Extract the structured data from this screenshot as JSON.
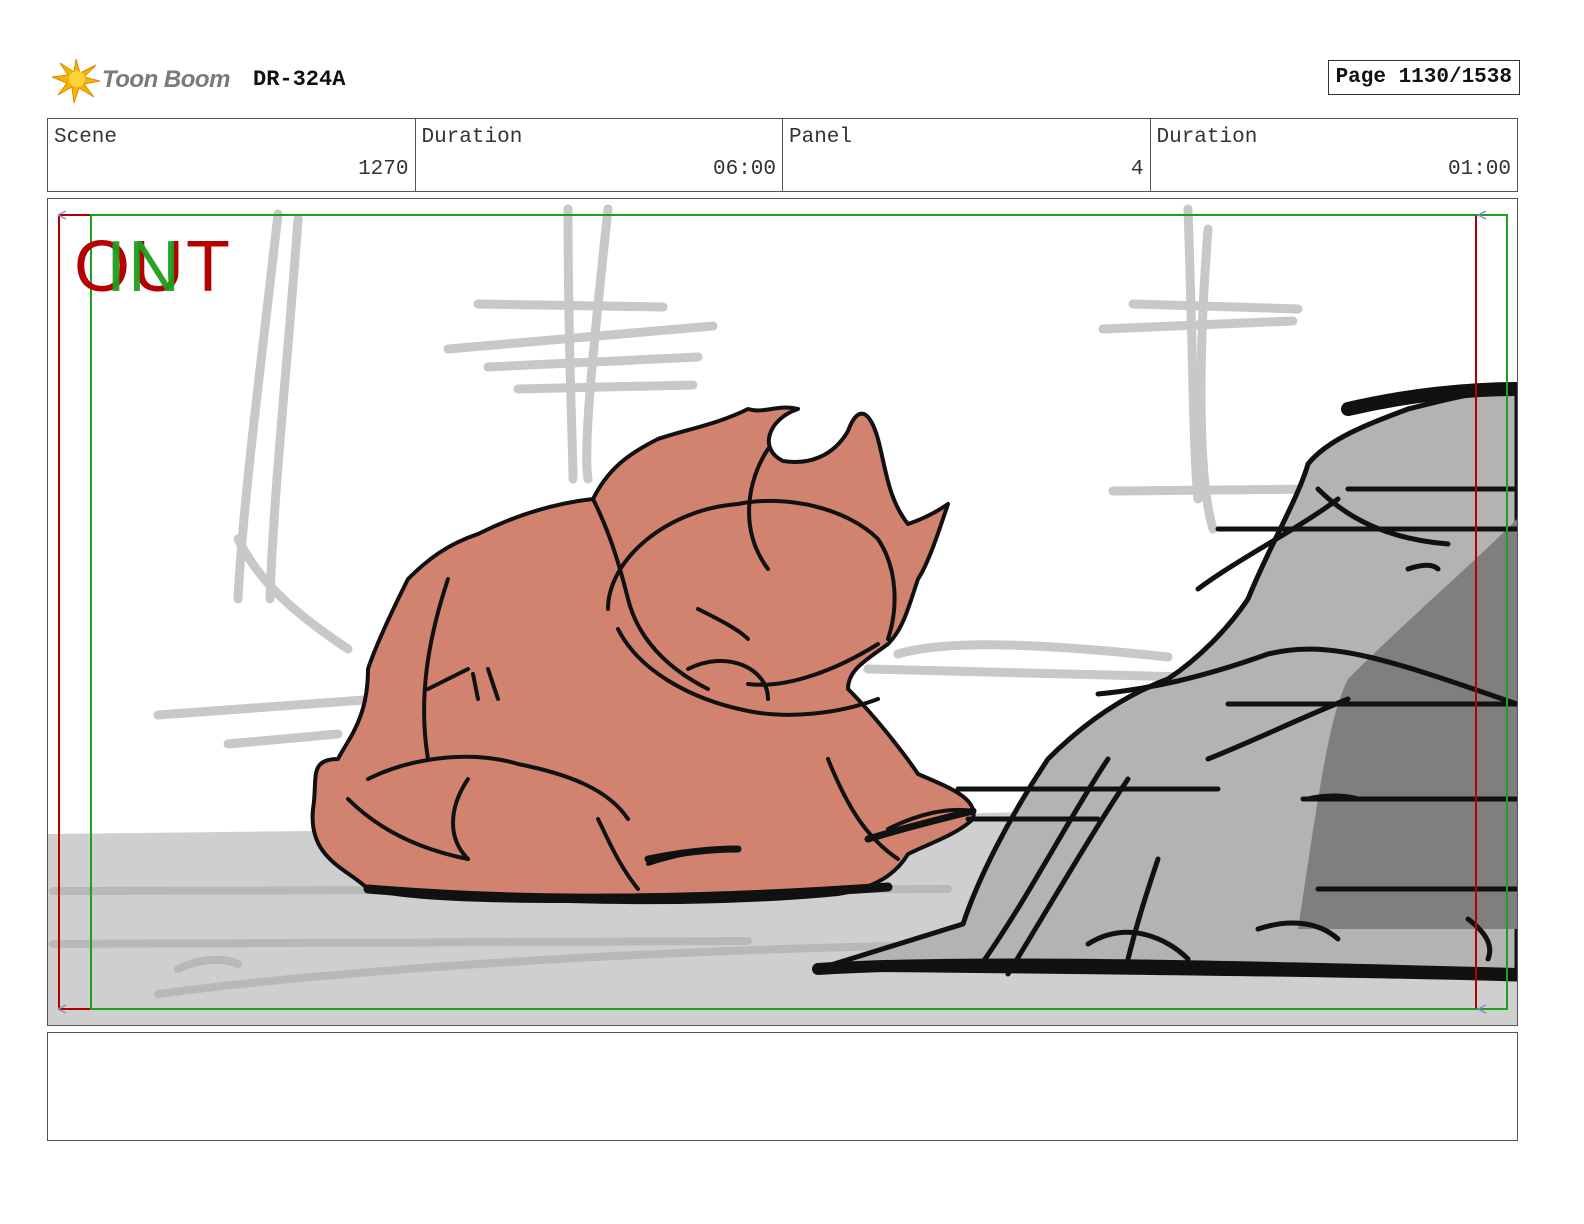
{
  "header": {
    "logo_text": "Toon Boom",
    "doc_id": "DR-324A",
    "page": "Page 1130/1538"
  },
  "info": [
    {
      "label": "Scene",
      "value": "1270"
    },
    {
      "label": "Duration",
      "value": "06:00"
    },
    {
      "label": "Panel",
      "value": "4"
    },
    {
      "label": "Duration",
      "value": "01:00"
    }
  ],
  "panel": {
    "out_label": "OUT",
    "in_label": "IN",
    "colors": {
      "creature": "#d28370",
      "rock_light": "#b3b3b3",
      "rock_dark": "#7f7f7f",
      "ground": "#cfcfcf",
      "frame_out": "#b40000",
      "frame_in": "#1ea01e"
    }
  },
  "notes": ""
}
